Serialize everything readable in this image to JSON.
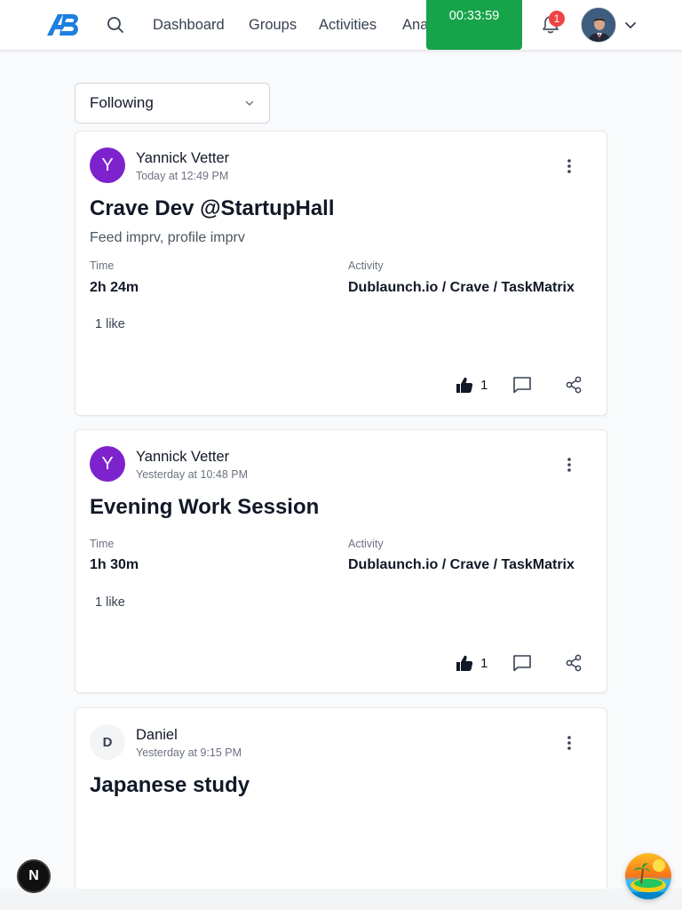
{
  "nav": {
    "links": [
      "Dashboard",
      "Groups",
      "Activities",
      "Analytics"
    ],
    "timer": "00:33:59",
    "notification_count": "1"
  },
  "filter": {
    "selected": "Following"
  },
  "posts": [
    {
      "avatar_letter": "Y",
      "author": "Yannick Vetter",
      "timestamp": "Today at 12:49 PM",
      "title": "Crave Dev @StartupHall",
      "description": "Feed imprv, profile imprv",
      "time_label": "Time",
      "time_value": "2h 24m",
      "activity_label": "Activity",
      "activity_value": "Dublaunch.io / Crave / TaskMatrix",
      "likes_text": "1 like",
      "like_count": "1"
    },
    {
      "avatar_letter": "Y",
      "author": "Yannick Vetter",
      "timestamp": "Yesterday at 10:48 PM",
      "title": "Evening Work Session",
      "time_label": "Time",
      "time_value": "1h 30m",
      "activity_label": "Activity",
      "activity_value": "Dublaunch.io / Crave / TaskMatrix",
      "likes_text": "1 like",
      "like_count": "1"
    },
    {
      "avatar_letter": "D",
      "author": "Daniel",
      "timestamp": "Yesterday at 9:15 PM",
      "title": "Japanese study"
    }
  ],
  "dev_badge": "N",
  "colors": {
    "brand_blue": "#1d7fe0",
    "timer_green": "#16a34a",
    "avatar_purple": "#7e22ce",
    "badge_red": "#ef4444"
  }
}
